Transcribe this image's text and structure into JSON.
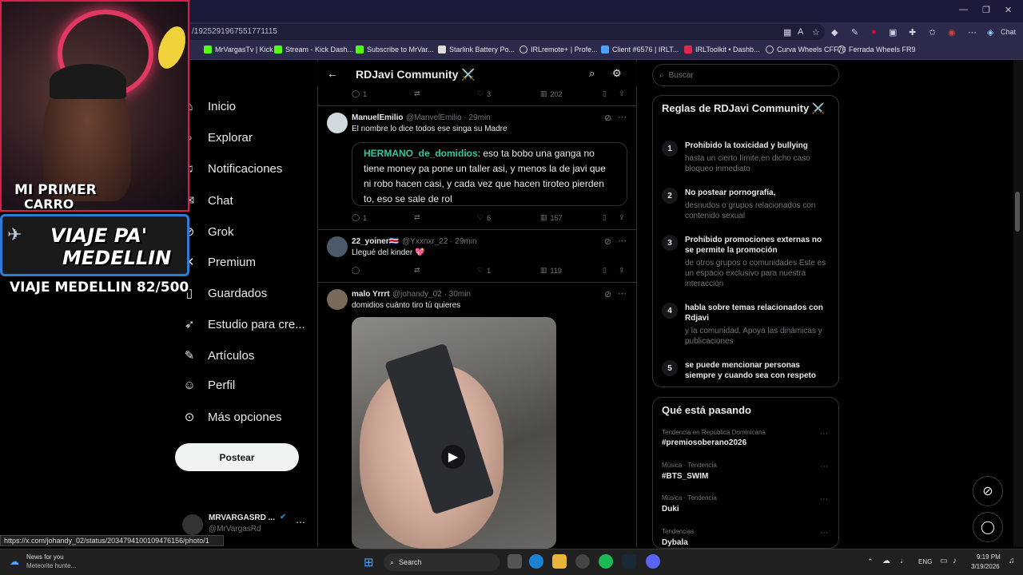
{
  "browser": {
    "url": "/1925291967551771115",
    "bookmarks": [
      "MrVargasTv | Kick",
      "Stream - Kick Dash...",
      "Subscribe to MrVar...",
      "Starlink Battery Po...",
      "IRLremote+ | Profe...",
      "Client #6576 | IRLT...",
      "IRLToolkit • Dashb...",
      "Curva Wheels CFF76",
      "Ferrada Wheels FR9"
    ],
    "chat_label": "Chat",
    "status_url": "https://x.com/johandy_02/status/2034794100109476156/photo/1"
  },
  "overlay": {
    "line1": "MI PRIMER",
    "line2": "CARRO",
    "badge1": "VIAJE PA'",
    "badge2": "MEDELLIN",
    "counter": "VIAJE MEDELLIN 82/500"
  },
  "nav": {
    "items": [
      "Inicio",
      "Explorar",
      "Notificaciones",
      "Chat",
      "Grok",
      "Premium",
      "Guardados",
      "Estudio para cre...",
      "Artículos",
      "Perfil",
      "Más opciones"
    ],
    "post_label": "Postear",
    "account_name": "MRVARGASRD ...",
    "account_handle": "@MrVargasRd"
  },
  "community": {
    "title": "RDJavi Community ⚔️"
  },
  "prev_stats": {
    "replies": "1",
    "retweets": "3",
    "views": "202"
  },
  "tweets": [
    {
      "name": "ManuelEmilio",
      "handle": "@ManvelEmilio · 29min",
      "text": "El nombre lo dice todos ese singa su Madre",
      "quote_author": "HERMANO_de_domidios",
      "quote_text": ": eso ta bobo una ganga no tiene money pa pone un taller asi, y menos la de javi que ni robo hacen casi, y cada vez que hacen tiroteo pierden to, eso se sale de rol",
      "replies": "1",
      "likes": "6",
      "views": "157"
    },
    {
      "name": "22_yoiner🇨🇷",
      "handle": "@Yxxnxr_22 · 29min",
      "text": "Llegué del kinder 💖",
      "replies": "",
      "likes": "1",
      "views": "119"
    },
    {
      "name": "malo Yrrrt",
      "handle": "@johandy_02 · 30min",
      "text": "domidios cuánto tiro tú quieres"
    }
  ],
  "search": {
    "placeholder": "Buscar"
  },
  "rules": {
    "heading": "Reglas de RDJavi Community ⚔️",
    "items": [
      {
        "num": "1",
        "title": "Prohibido la toxicidad y bullying",
        "desc": "hasta un cierto límite,en dicho caso bloqueo inmediato"
      },
      {
        "num": "2",
        "title": "No postear pornografía,",
        "desc": "desnudos o grupos relacionados con contenido sexual"
      },
      {
        "num": "3",
        "title": "Prohibido promociones externas no se permite la promoción",
        "desc": "de otros grupos o comunidades Este es un espacio exclusivo para nuestra interacción"
      },
      {
        "num": "4",
        "title": "habla sobre temas relacionados con Rdjavi",
        "desc": "y la comunidad. Apoya las dinámicas y publicaciones"
      },
      {
        "num": "5",
        "title": "se puede mencionar personas siempre y cuando sea con respeto",
        "desc": ""
      }
    ]
  },
  "trending": {
    "heading": "Qué está pasando",
    "items": [
      {
        "category": "Tendencia en República Dominicana",
        "name": "#premiosoberano2026"
      },
      {
        "category": "Música · Tendencia",
        "name": "#BTS_SWIM"
      },
      {
        "category": "Música · Tendencia",
        "name": "Duki"
      },
      {
        "category": "Tendencias",
        "name": "Dybala"
      }
    ]
  },
  "taskbar": {
    "news_title": "News for you",
    "news_sub": "Meteorite hunte...",
    "search_label": "Search",
    "lang": "ENG",
    "time": "9:19 PM",
    "date": "3/19/2026"
  },
  "colors": {
    "accent": "#1d9bf0",
    "quote_author": "#35c7a0",
    "webcam_border": "#d4204a"
  }
}
